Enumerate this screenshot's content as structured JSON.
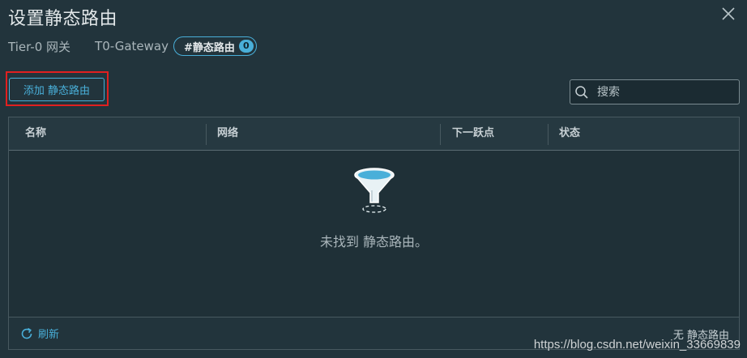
{
  "dialog": {
    "title": "设置静态路由",
    "close_icon": "close-icon"
  },
  "breadcrumb": {
    "tier": "Tier-0 网关",
    "gateway": "T0-Gateway",
    "tag_label": "#静态路由",
    "tag_count": "0"
  },
  "toolbar": {
    "add_label": "添加 静态路由",
    "search_placeholder": "搜索"
  },
  "table": {
    "columns": [
      "名称",
      "网络",
      "下一跃点",
      "状态"
    ],
    "rows": [],
    "empty_message": "未找到 静态路由。",
    "empty_icon": "filter-funnel-icon"
  },
  "footer": {
    "refresh_label": "刷新",
    "count_text": "无 静态路由"
  },
  "watermark": "https://blog.csdn.net/weixin_33669839",
  "colors": {
    "accent": "#49afd9",
    "background": "#22343c",
    "highlight": "#e02020"
  }
}
